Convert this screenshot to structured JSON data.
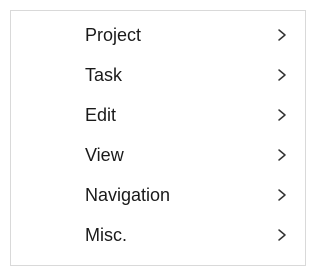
{
  "menu": {
    "items": [
      {
        "label": "Project",
        "icon": "chevron-right-icon"
      },
      {
        "label": "Task",
        "icon": "chevron-right-icon"
      },
      {
        "label": "Edit",
        "icon": "chevron-right-icon"
      },
      {
        "label": "View",
        "icon": "chevron-right-icon"
      },
      {
        "label": "Navigation",
        "icon": "chevron-right-icon"
      },
      {
        "label": "Misc.",
        "icon": "chevron-right-icon"
      }
    ]
  }
}
